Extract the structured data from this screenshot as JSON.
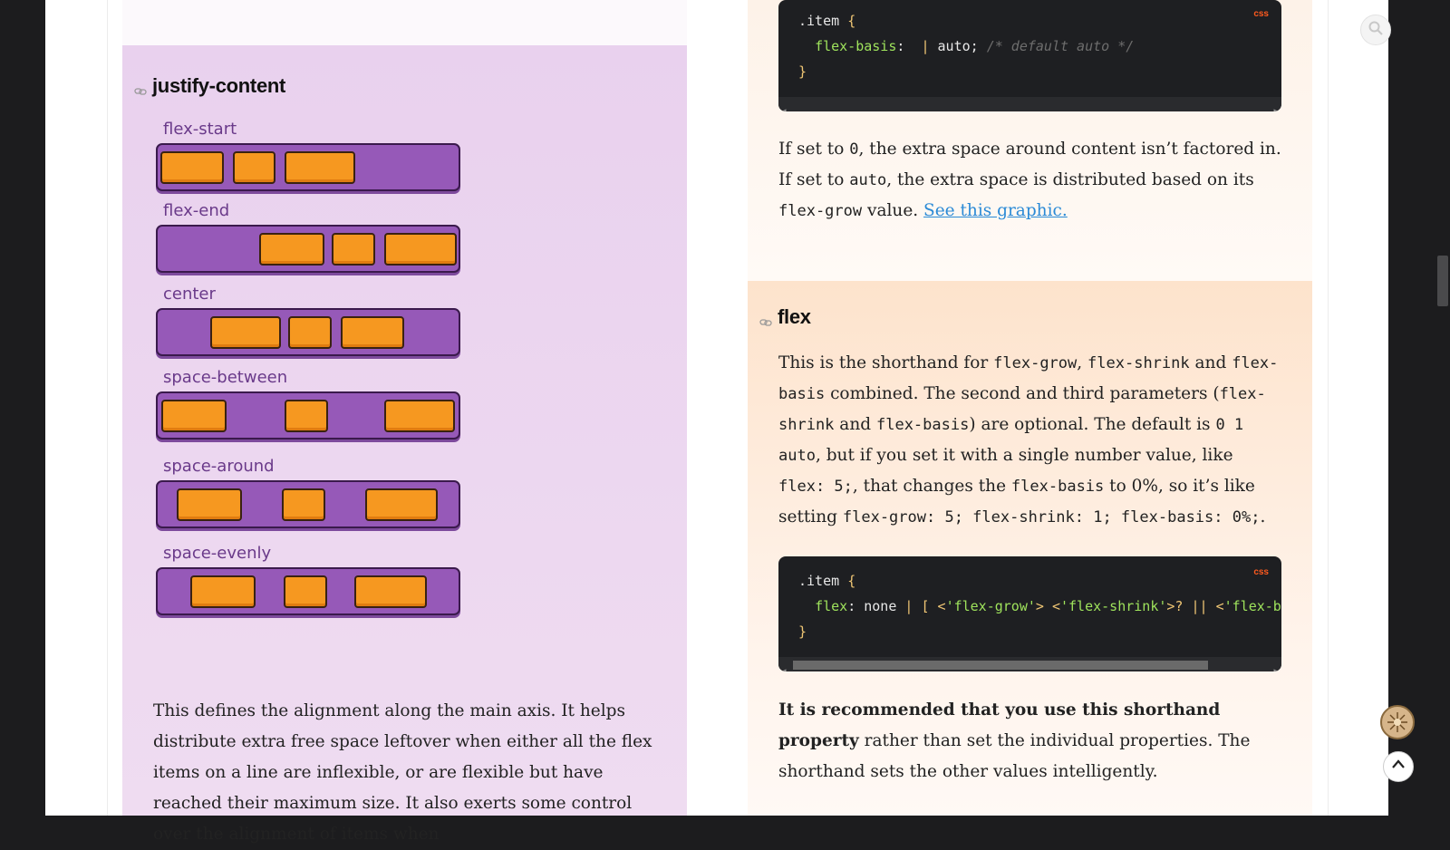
{
  "justify_section": {
    "heading": "justify-content",
    "diagram_rows": [
      {
        "label": "flex-start"
      },
      {
        "label": "flex-end"
      },
      {
        "label": "center"
      },
      {
        "label": "space-between"
      },
      {
        "label": "space-around"
      },
      {
        "label": "space-evenly"
      }
    ],
    "paragraph": "This defines the alignment along the main axis. It helps distribute extra free space leftover when either all the flex items on a line are inflexible, or are flexible but have reached their maximum size. It also exerts some control over the alignment of items when"
  },
  "flex_basis_section": {
    "code": {
      "lang": "css",
      "selector": ".item",
      "open_brace": "{",
      "prop": "flex-basis",
      "colon": ":",
      "separator": "|",
      "value": "auto;",
      "comment": "/* default auto */",
      "close_brace": "}"
    },
    "p_part1": "If set to ",
    "p_code1": "0",
    "p_part2": ", the extra space around content isn’t factored in. If set to ",
    "p_code2": "auto",
    "p_part3": ", the extra space is distributed based on its ",
    "p_code3": "flex-grow",
    "p_part4": " value. ",
    "link_text": "See this graphic."
  },
  "flex_section": {
    "heading": "flex",
    "p1": "This is the shorthand for ",
    "c1": "flex-grow",
    "p2": ", ",
    "c2": "flex-shrink",
    "p3": " and ",
    "c3": "flex-basis",
    "p4": " combined. The second and third parameters (",
    "c4": "flex-shrink",
    "p5": " and ",
    "c5": "flex-basis",
    "p6": ") are optional. The default is ",
    "c6": "0 1 auto",
    "p7": ", but if you set it with a single number value, like ",
    "c7": "flex: 5;",
    "p8": ", that changes the ",
    "c8": "flex-basis",
    "p9": " to 0%, so it’s like setting ",
    "c9": "flex-grow: 5; flex-shrink: 1; flex-basis: 0%;",
    "p10": ".",
    "code": {
      "lang": "css",
      "selector": ".item",
      "open_brace": "{",
      "prop": "flex",
      "colon": ":",
      "value_start": "none",
      "bar1": "|",
      "bracket": "[",
      "lt1": "<",
      "str1": "'flex-grow'",
      "gt1": ">",
      "lt2": "<",
      "str2": "'flex-shrink'",
      "gt2": ">?",
      "bar2": "||",
      "lt3": "<",
      "str3": "'flex-bas",
      "close_brace": "}"
    },
    "recommend_bold": "It is recommended that you use this shorthand property",
    "recommend_rest": " rather than set the individual properties. The shorthand sets the other values intelligently."
  },
  "icons": {
    "search": "search-icon",
    "cookie": "cookie-icon",
    "back_to_top": "chevron-up-icon",
    "anchor": "link-icon"
  },
  "colors": {
    "accent_link": "#2a8ad6",
    "diagram_container": "#9659b8",
    "diagram_item": "#f69820",
    "code_bg": "#1e1f22",
    "code_prop": "#9fe35c"
  }
}
